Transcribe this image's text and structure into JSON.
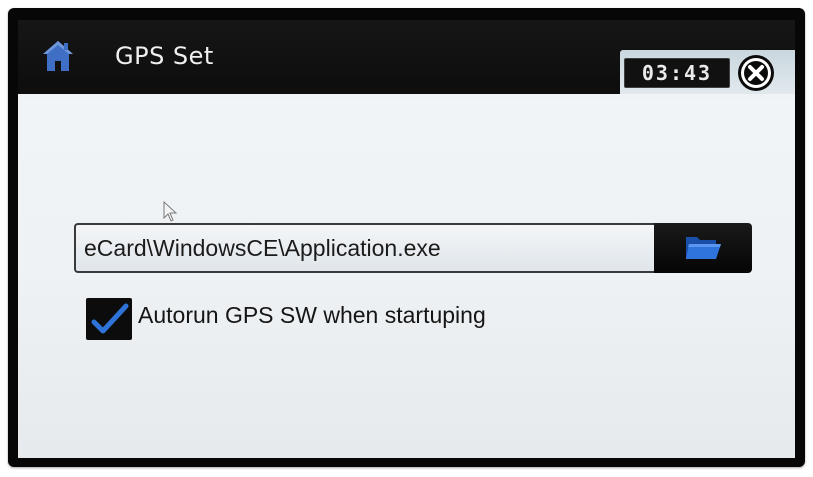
{
  "titlebar": {
    "title": "GPS Set",
    "clock": "03:43",
    "home_icon": "home-icon",
    "close_icon": "close-icon"
  },
  "path": {
    "value": "eCard\\WindowsCE\\Application.exe",
    "browse_icon": "folder-open-icon"
  },
  "autorun": {
    "checked": true,
    "label": "Autorun GPS SW when startuping"
  },
  "colors": {
    "titlebar_bg": "#111111",
    "screen_bg": "#eef2f4",
    "folder_blue": "#1e63c8",
    "check_blue": "#2f73d8"
  }
}
